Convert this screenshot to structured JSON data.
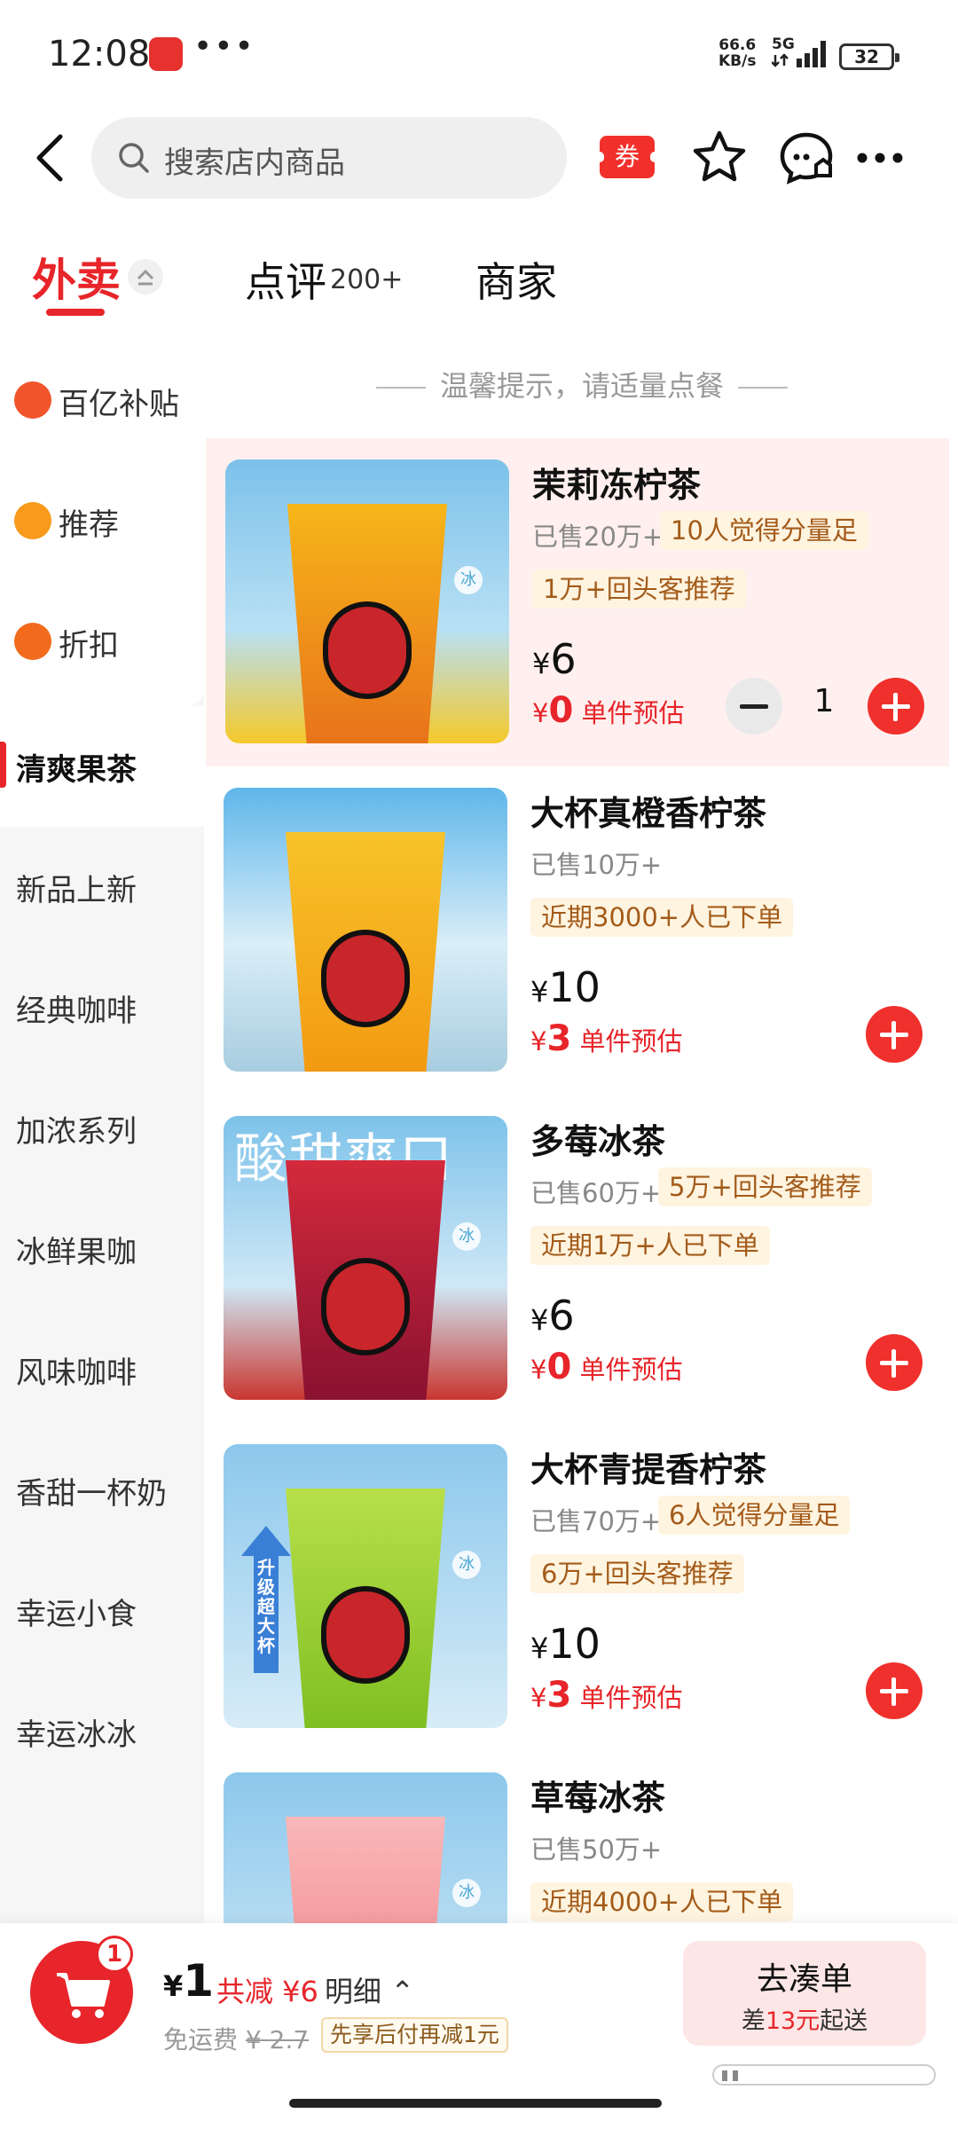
{
  "status_bar": {
    "time": "12:08",
    "dots": "•••",
    "net_speed": "66.6",
    "net_unit": "KB/s",
    "network": "5G",
    "battery": "32"
  },
  "search": {
    "placeholder": "搜索店内商品"
  },
  "actions": {
    "coupon": "券"
  },
  "tabs": [
    {
      "label": "外卖"
    },
    {
      "label": "点评",
      "count": "200+"
    },
    {
      "label": "商家"
    }
  ],
  "sidebar": {
    "items": [
      {
        "label": "百亿补贴"
      },
      {
        "label": "推荐"
      },
      {
        "label": "折扣"
      },
      {
        "label": "清爽果茶"
      },
      {
        "label": "新品上新"
      },
      {
        "label": "经典咖啡"
      },
      {
        "label": "加浓系列"
      },
      {
        "label": "冰鲜果咖"
      },
      {
        "label": "风味咖啡"
      },
      {
        "label": "香甜一杯奶"
      },
      {
        "label": "幸运小食"
      },
      {
        "label": "幸运冰冰"
      }
    ]
  },
  "tip": "温馨提示，请适量点餐",
  "products": [
    {
      "name": "茉莉冻柠茶",
      "sold": "已售20万+",
      "tag1": "10人觉得分量足",
      "tag2": "1万+回头客推荐",
      "price": "6",
      "est_price": "0",
      "est_label": "单件预估",
      "qty": "1",
      "ice": "冰"
    },
    {
      "name": "大杯真橙香柠茶",
      "sold": "已售10万+",
      "tag2": "近期3000+人已下单",
      "price": "10",
      "est_price": "3",
      "est_label": "单件预估"
    },
    {
      "name": "多莓冰茶",
      "sold": "已售60万+",
      "tag1": "5万+回头客推荐",
      "tag2": "近期1万+人已下单",
      "price": "6",
      "est_price": "0",
      "est_label": "单件预估",
      "caption": "酸甜爽口",
      "ice": "冰"
    },
    {
      "name": "大杯青提香柠茶",
      "sold": "已售70万+",
      "tag1": "6人觉得分量足",
      "tag2": "6万+回头客推荐",
      "price": "10",
      "est_price": "3",
      "est_label": "单件预估",
      "caption": "升级超大杯",
      "ice": "冰"
    },
    {
      "name": "草莓冰茶",
      "sold": "已售50万+",
      "tag2": "近期4000+人已下单",
      "ice": "冰"
    }
  ],
  "currency": "¥",
  "cart": {
    "badge": "1",
    "total": "1",
    "discount": "共减 ¥6",
    "detail": "明细",
    "delivery_label": "免运费",
    "delivery_orig": "¥ 2.7",
    "pay_later": "先享后付再减1元",
    "checkout": "去凑单",
    "min_prefix": "差",
    "min_amount": "13元",
    "min_suffix": "起送"
  },
  "colors": {
    "brand_red": "#e7252a",
    "tag_bg": "#fff4e0",
    "tag_text": "#a35b1a"
  }
}
